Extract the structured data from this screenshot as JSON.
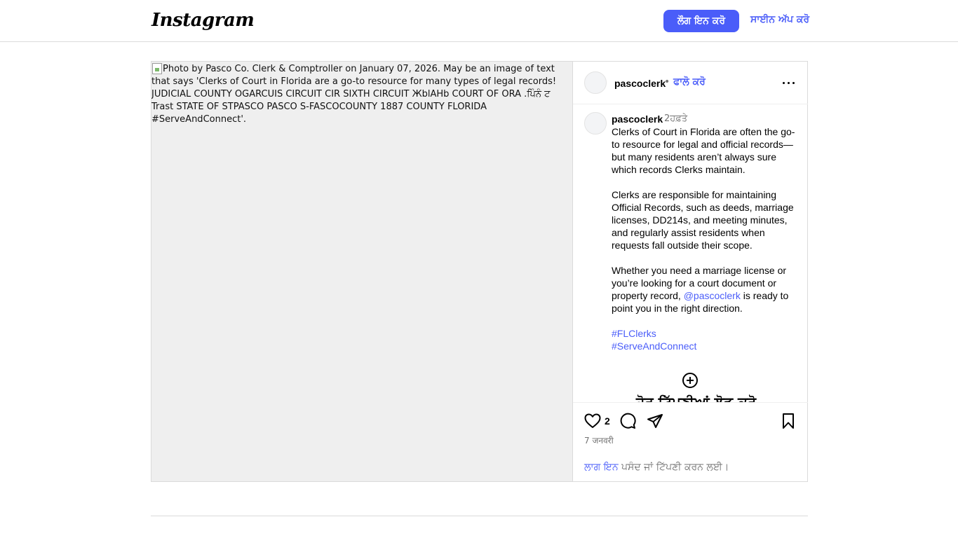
{
  "header": {
    "logo_text": "Instagram",
    "login_label": "ਲੌਗ ਇਨ ਕਰੋ",
    "signup_label": "ਸਾਈਨ ਅੱਪ ਕਰੋ"
  },
  "media": {
    "alt_text": "Photo by Pasco Co. Clerk & Comptroller on January 07, 2026. May be an image of text that says 'Clerks of Court in Florida are a go-to resource for many types of legal records! JUDICIAL COUNTY OGARCUIS CIRCUIT CIR SIXTH CIRCUIT ЖblAHb COURT OF ORA .ਪਿੰਨੰ ਟ Trast STATE OF STPASCO PASCO S-FASCOCOUNTY 1887 COUNTY FLORIDA #ServeAndConnect'."
  },
  "post_header": {
    "username": "pascoclerk",
    "separator": "•",
    "follow_label": "ਫਾਲੋ ਕਰੋ"
  },
  "caption": {
    "username": "pascoclerk",
    "time": "2ਹਫ਼ਤੇ",
    "paragraph1": "Clerks of Court in Florida are often the go-to resource for legal and official records—but many residents aren’t always sure which records Clerks maintain.",
    "paragraph2": "Clerks are responsible for maintaining Official Records, such as deeds, marriage licenses, DD214s, and meeting minutes, and regularly assist residents when requests fall outside their scope.",
    "paragraph3_before": "Whether you need a marriage license or you’re looking for a court document or property record,",
    "mention": "@pascoclerk",
    "paragraph3_after": "is ready to point you in the right direction.",
    "hashtag1": "#FLClerks",
    "hashtag2": "#ServeAndConnect",
    "cutoff_text": "ਹੋਰ ਟਿੱਪਣੀਆਂ ਲੋਡ ਕਰੋ"
  },
  "actions": {
    "like_count": "2",
    "date": "7 जनवरी",
    "login_link": "ਲਾਗ ਇਨ",
    "login_rest": "ਪਸੰਦ ਜਾਂ ਟਿੱਪਣੀ ਕਰਨ ਲਈ।"
  },
  "icons": {
    "like": "heart-icon",
    "comment": "comment-bubble-icon",
    "share": "paper-plane-icon",
    "save": "bookmark-icon",
    "more": "more-options-icon",
    "load_more": "plus-circle-icon"
  },
  "colors": {
    "accent": "#4a5df9",
    "muted_text": "#737373",
    "border": "#dbdbdb",
    "media_placeholder": "#efefef"
  }
}
